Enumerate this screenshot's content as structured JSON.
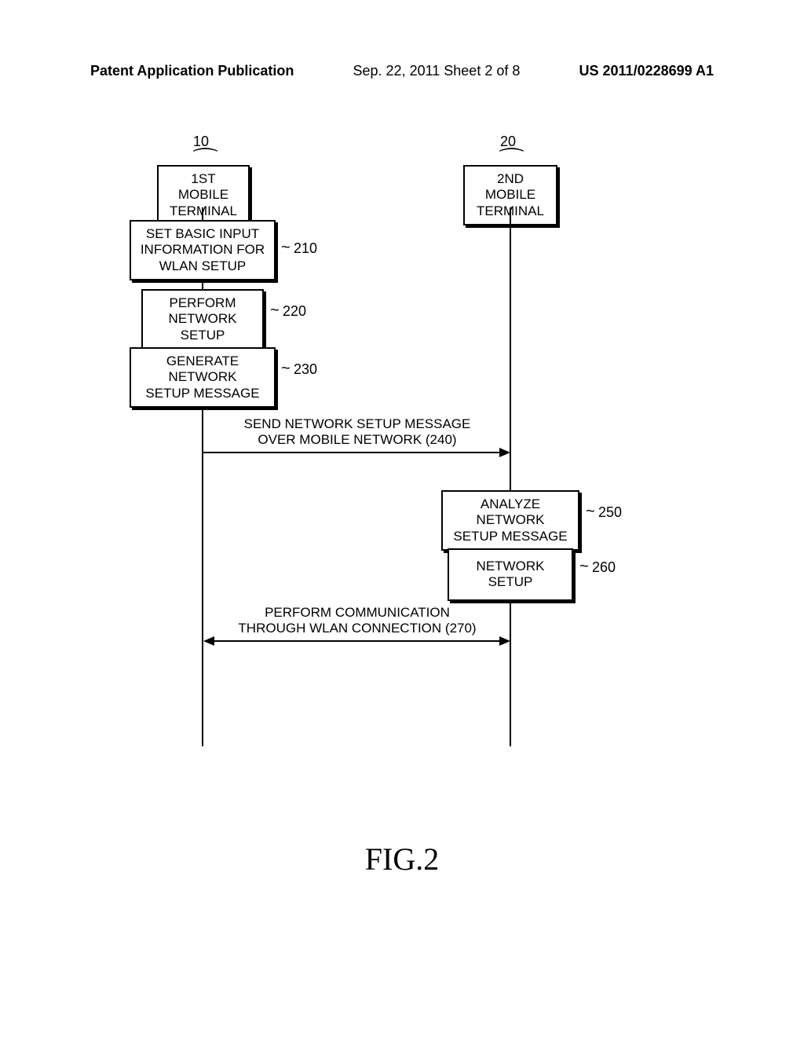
{
  "header": {
    "left": "Patent Application Publication",
    "center": "Sep. 22, 2011  Sheet 2 of 8",
    "right": "US 2011/0228699 A1"
  },
  "terminals": {
    "t1": {
      "ref": "10",
      "label": "1ST MOBILE\nTERMINAL"
    },
    "t2": {
      "ref": "20",
      "label": "2ND MOBILE\nTERMINAL"
    }
  },
  "steps": {
    "s210": {
      "ref": "210",
      "label": "SET BASIC INPUT\nINFORMATION FOR\nWLAN SETUP"
    },
    "s220": {
      "ref": "220",
      "label": "PERFORM\nNETWORK SETUP"
    },
    "s230": {
      "ref": "230",
      "label": "GENERATE NETWORK\nSETUP MESSAGE"
    },
    "s250": {
      "ref": "250",
      "label": "ANALYZE NETWORK\nSETUP MESSAGE"
    },
    "s260": {
      "ref": "260",
      "label": "NETWORK SETUP"
    }
  },
  "messages": {
    "m240": "SEND NETWORK SETUP MESSAGE\nOVER MOBILE NETWORK (240)",
    "m270": "PERFORM COMMUNICATION\nTHROUGH WLAN CONNECTION (270)"
  },
  "figure": "FIG.2",
  "chart_data": {
    "type": "sequence-diagram",
    "participants": [
      {
        "id": "10",
        "name": "1ST MOBILE TERMINAL"
      },
      {
        "id": "20",
        "name": "2ND MOBILE TERMINAL"
      }
    ],
    "events": [
      {
        "ref": "210",
        "at": "10",
        "type": "self",
        "label": "SET BASIC INPUT INFORMATION FOR WLAN SETUP"
      },
      {
        "ref": "220",
        "at": "10",
        "type": "self",
        "label": "PERFORM NETWORK SETUP"
      },
      {
        "ref": "230",
        "at": "10",
        "type": "self",
        "label": "GENERATE NETWORK SETUP MESSAGE"
      },
      {
        "ref": "240",
        "from": "10",
        "to": "20",
        "type": "message",
        "label": "SEND NETWORK SETUP MESSAGE OVER MOBILE NETWORK"
      },
      {
        "ref": "250",
        "at": "20",
        "type": "self",
        "label": "ANALYZE NETWORK SETUP MESSAGE"
      },
      {
        "ref": "260",
        "at": "20",
        "type": "self",
        "label": "NETWORK SETUP"
      },
      {
        "ref": "270",
        "from": "10",
        "to": "20",
        "type": "bidirectional",
        "label": "PERFORM COMMUNICATION THROUGH WLAN CONNECTION"
      }
    ]
  }
}
